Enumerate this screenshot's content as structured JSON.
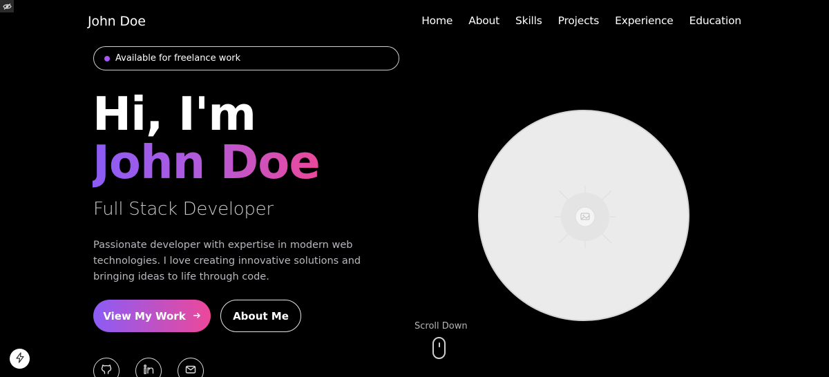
{
  "brand": "John Doe",
  "nav": {
    "items": [
      "Home",
      "About",
      "Skills",
      "Projects",
      "Experience",
      "Education"
    ]
  },
  "availability": "Available for freelance work",
  "hero": {
    "greeting": "Hi, I'm",
    "name": "John Doe",
    "role": "Full Stack Developer",
    "bio": "Passionate developer with expertise in modern web technologies. I love creating innovative solutions and bringing ideas to life through code."
  },
  "buttons": {
    "primary": "View My Work",
    "secondary": "About Me"
  },
  "scroll": {
    "label": "Scroll Down"
  },
  "social": [
    "github-icon",
    "linkedin-icon",
    "mail-icon"
  ],
  "colors": {
    "background": "#000000",
    "accent_purple": "#8b5cf6",
    "accent_pink": "#ec4899",
    "avatar_placeholder": "#ebebeb"
  }
}
